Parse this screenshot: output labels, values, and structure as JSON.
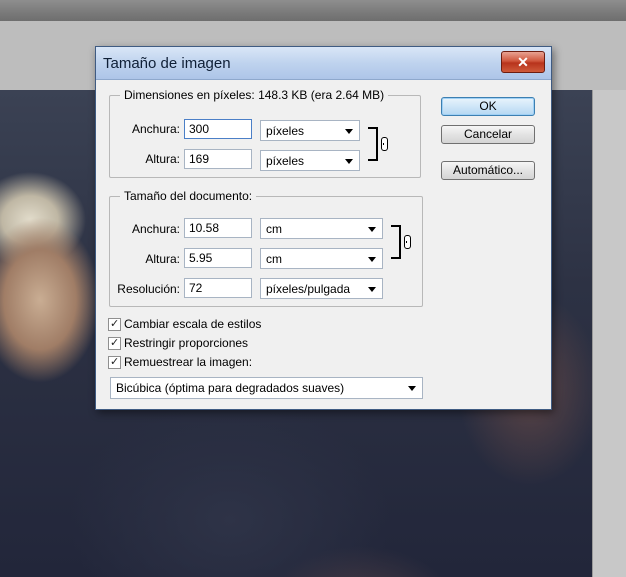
{
  "dialog": {
    "title": "Tamaño de imagen",
    "close_label": "✕"
  },
  "pixel_dimensions": {
    "legend": "Dimensiones en píxeles: 148.3 KB (era 2.64 MB)",
    "width_label": "Anchura:",
    "width_value": "300",
    "width_unit": "píxeles",
    "height_label": "Altura:",
    "height_value": "169",
    "height_unit": "píxeles"
  },
  "document_size": {
    "legend": "Tamaño del documento:",
    "width_label": "Anchura:",
    "width_value": "10.58",
    "width_unit": "cm",
    "height_label": "Altura:",
    "height_value": "5.95",
    "height_unit": "cm",
    "resolution_label": "Resolución:",
    "resolution_value": "72",
    "resolution_unit": "píxeles/pulgada"
  },
  "options": {
    "scale_styles": {
      "label": "Cambiar escala de estilos",
      "checked": true
    },
    "constrain": {
      "label": "Restringir proporciones",
      "checked": true
    },
    "resample": {
      "label": "Remuestrear la imagen:",
      "checked": true
    },
    "resample_method": "Bicúbica (óptima para degradados suaves)"
  },
  "buttons": {
    "ok": "OK",
    "cancel": "Cancelar",
    "auto": "Automático..."
  },
  "check_glyph": "✓"
}
